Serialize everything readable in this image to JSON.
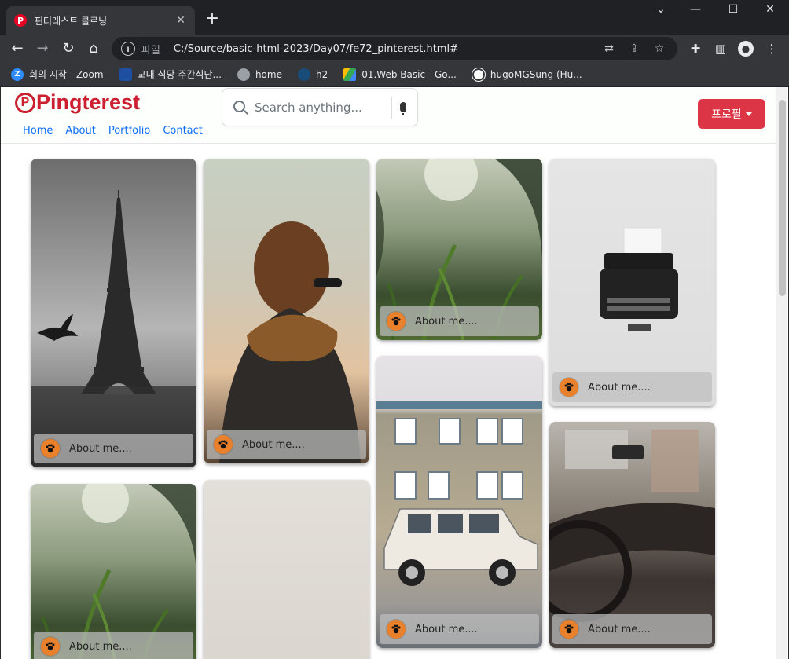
{
  "browser": {
    "tab_title": "핀터레스트 클로닝",
    "tab_favicon": "P",
    "new_tab_label": "+",
    "url_scheme": "파일",
    "url": "C:/Source/basic-html-2023/Day07/fe72_pinterest.html#",
    "bookmarks": [
      {
        "label": "회의 시작 - Zoom",
        "icon": "Z",
        "color": "#2d8cff"
      },
      {
        "label": "교내 식당 주간식단...",
        "icon": "",
        "color": "#1f4fa0"
      },
      {
        "label": "home",
        "icon": "",
        "color": "#9aa0a6"
      },
      {
        "label": "h2",
        "icon": "",
        "color": "#1a4c7a"
      },
      {
        "label": "01.Web Basic - Go...",
        "icon": "",
        "color": "#34a853"
      },
      {
        "label": "hugoMGSung (Hu...",
        "icon": "",
        "color": "#ffffff"
      }
    ]
  },
  "site": {
    "brand": "Pingterest",
    "brand_icon": "P",
    "brand_color": "#cc2030",
    "nav": [
      "Home",
      "About",
      "Portfolio",
      "Contact"
    ],
    "search_placeholder": "Search anything...",
    "profile_button": "프로필",
    "accent": "#dc3545"
  },
  "cards": [
    {
      "id": "eiffel",
      "caption": "About me...."
    },
    {
      "id": "woman",
      "caption": "About me...."
    },
    {
      "id": "grass",
      "caption": "About me...."
    },
    {
      "id": "typewriter",
      "caption": "About me...."
    },
    {
      "id": "house",
      "caption": "About me...."
    },
    {
      "id": "car",
      "caption": "About me...."
    },
    {
      "id": "grass-2",
      "caption": "About me...."
    },
    {
      "id": "blank",
      "caption": ""
    }
  ]
}
